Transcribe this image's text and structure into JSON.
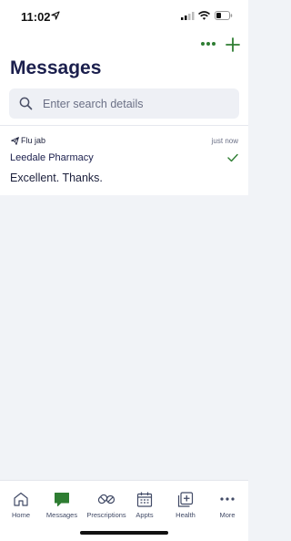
{
  "status_bar": {
    "time": "11:02"
  },
  "header": {
    "title": "Messages"
  },
  "search": {
    "placeholder": "Enter search details",
    "value": ""
  },
  "messages": [
    {
      "subject": "Flu jab",
      "time": "just now",
      "sender": "Leedale Pharmacy",
      "preview": "Excellent. Thanks.",
      "status": "read"
    }
  ],
  "tabbar": {
    "items": [
      {
        "label": "Home",
        "icon": "home-icon"
      },
      {
        "label": "Messages",
        "icon": "messages-icon"
      },
      {
        "label": "Prescriptions",
        "icon": "pills-icon"
      },
      {
        "label": "Appts",
        "icon": "calendar-icon"
      },
      {
        "label": "Health",
        "icon": "health-record-icon"
      },
      {
        "label": "More",
        "icon": "more-icon"
      }
    ],
    "active": "Messages"
  },
  "colors": {
    "accent": "#2e7d32",
    "title": "#1b1f4d",
    "background": "#f1f3f7"
  }
}
